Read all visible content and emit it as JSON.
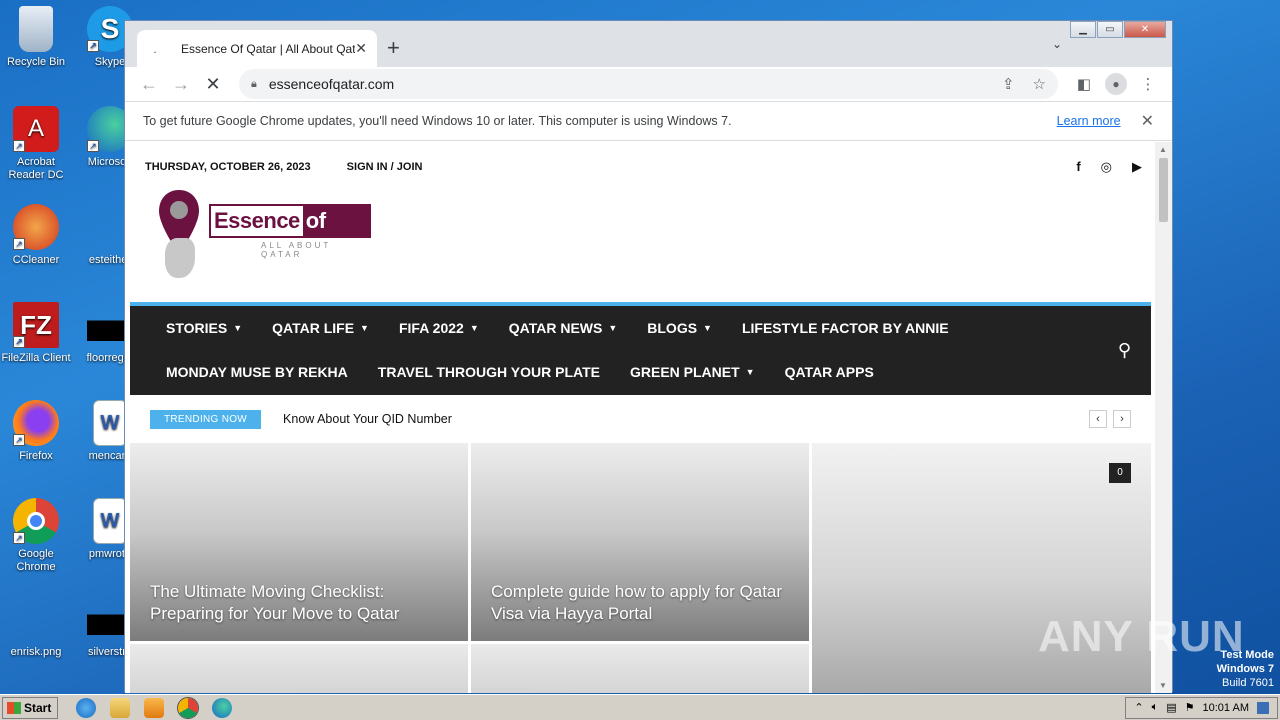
{
  "desktop": {
    "icons": [
      {
        "label": "Recycle Bin"
      },
      {
        "label": "Skype"
      },
      {
        "label": "Acrobat Reader DC"
      },
      {
        "label": "Microsoft"
      },
      {
        "label": "CCleaner"
      },
      {
        "label": "esteither"
      },
      {
        "label": "FileZilla Client"
      },
      {
        "label": "floorregar"
      },
      {
        "label": "Firefox"
      },
      {
        "label": "mencare"
      },
      {
        "label": "Google Chrome"
      },
      {
        "label": "pmwrote"
      },
      {
        "label": "enrisk.png"
      },
      {
        "label": "silverstru"
      }
    ]
  },
  "browser": {
    "tab_title": "Essence Of Qatar | All About Qatar",
    "tab_favicon": ".",
    "url": "essenceofqatar.com",
    "infobar_message": "To get future Google Chrome updates, you'll need Windows 10 or later. This computer is using Windows 7.",
    "infobar_link": "Learn more"
  },
  "site": {
    "date": "THURSDAY, OCTOBER 26, 2023",
    "signin": "SIGN IN / JOIN",
    "logo_word1": "Essence ",
    "logo_word2": "of Qatar",
    "logo_tagline": "ALL ABOUT QATAR",
    "nav_row1": [
      {
        "label": "STORIES",
        "caret": "▼"
      },
      {
        "label": "QATAR LIFE",
        "caret": "▼"
      },
      {
        "label": "FIFA 2022",
        "caret": "▼"
      },
      {
        "label": "QATAR NEWS",
        "caret": "▼"
      },
      {
        "label": "BLOGS",
        "caret": "▼"
      },
      {
        "label": "LIFESTYLE FACTOR BY ANNIE",
        "caret": ""
      }
    ],
    "nav_row2": [
      {
        "label": "MONDAY MUSE BY REKHA",
        "caret": ""
      },
      {
        "label": "TRAVEL THROUGH YOUR PLATE",
        "caret": ""
      },
      {
        "label": "GREEN PLANET",
        "caret": "▼"
      },
      {
        "label": "QATAR APPS",
        "caret": ""
      }
    ],
    "trending_badge": "TRENDING NOW",
    "trending_text": "Know About Your QID Number",
    "cards": [
      {
        "title": "The Ultimate Moving Checklist: Preparing for Your Move to Qatar"
      },
      {
        "title": "Complete guide how to apply for Qatar Visa via Hayya Portal"
      },
      {
        "comments": "0"
      }
    ]
  },
  "watermark": "ANY RUN",
  "testmode": {
    "line1": "Test Mode",
    "line2": "Windows 7",
    "line3": "Build 7601"
  },
  "taskbar": {
    "start_label": "Start",
    "clock": "10:01 AM"
  },
  "colors": {
    "brand": "#6b1240",
    "nav_bg": "#222222",
    "accent": "#4db2ec"
  }
}
